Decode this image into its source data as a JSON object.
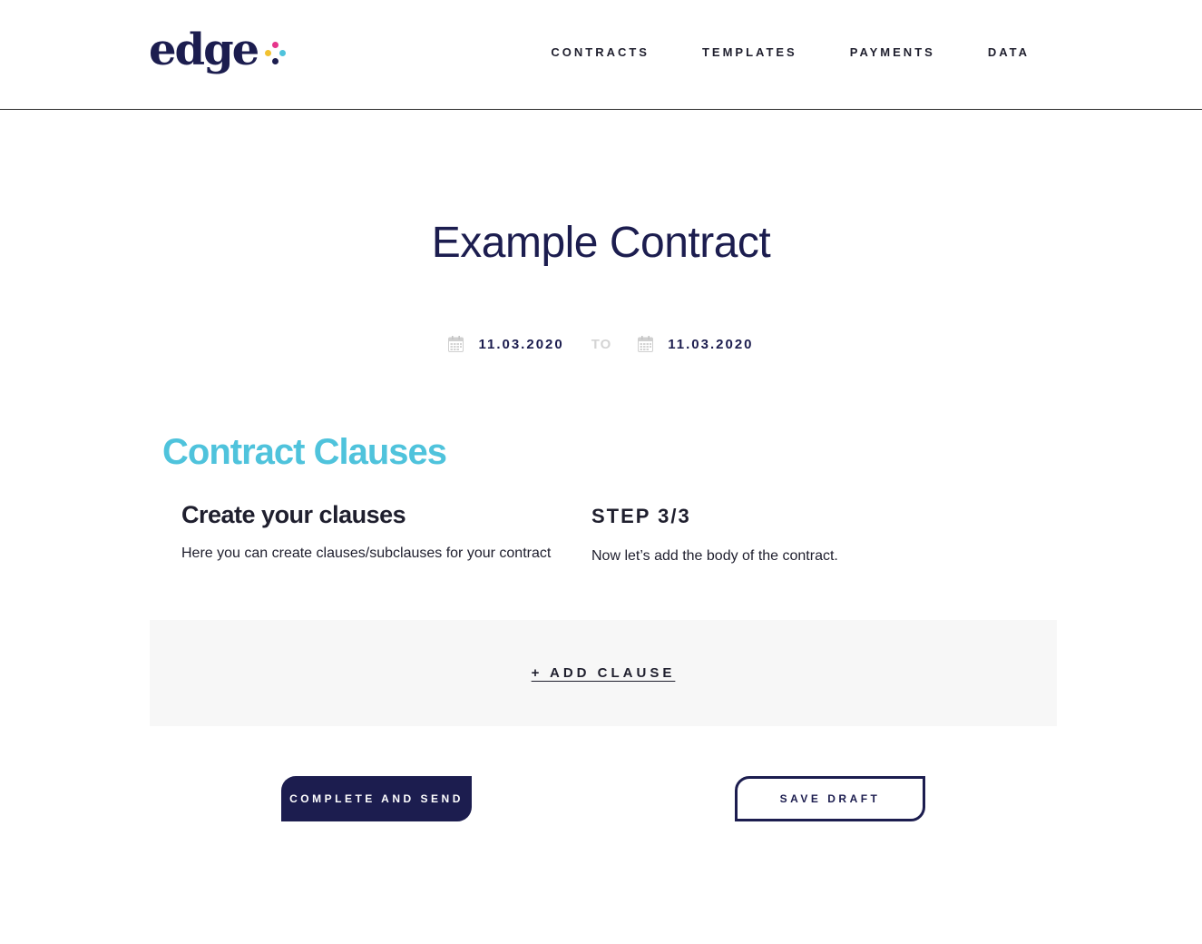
{
  "brand": {
    "logo_text": "edge",
    "colors": {
      "navy": "#1c1d4f",
      "cyan": "#4fc3dc",
      "pink": "#e6358b",
      "yellow": "#f2c230",
      "panel": "#f7f7f7"
    }
  },
  "nav": {
    "items": [
      {
        "label": "CONTRACTS"
      },
      {
        "label": "TEMPLATES"
      },
      {
        "label": "PAYMENTS"
      },
      {
        "label": "DATA"
      }
    ]
  },
  "page": {
    "title": "Example Contract"
  },
  "dates": {
    "start": "11.03.2020",
    "separator": "TO",
    "end": "11.03.2020",
    "icon": "calendar-icon"
  },
  "clauses": {
    "heading": "Contract Clauses",
    "left_title": "Create your clauses",
    "left_desc": "Here you can create clauses/subclauses for your contract",
    "step_label": "STEP 3/3",
    "step_desc": "Now let’s add the body of the contract.",
    "add_label": "+ ADD CLAUSE"
  },
  "actions": {
    "complete_label": "COMPLETE AND SEND",
    "save_label": "SAVE DRAFT"
  }
}
